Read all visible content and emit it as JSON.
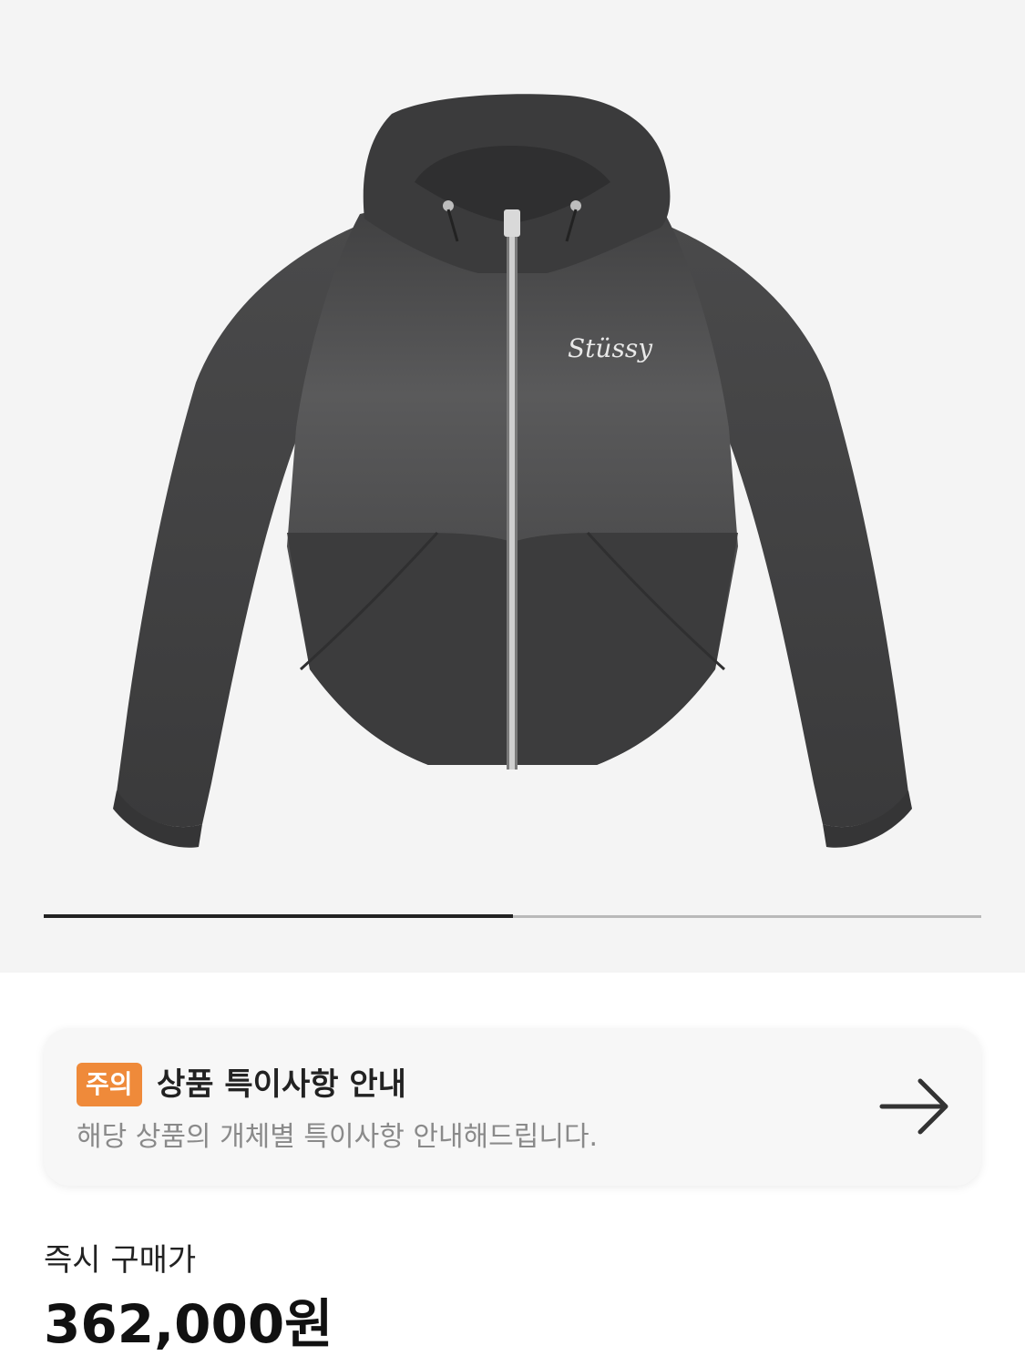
{
  "gallery": {
    "image_alt": "stüssy hooded zip jacket, charcoal",
    "logo_text": "Stüssy",
    "progress_fraction": 0.5
  },
  "notice": {
    "badge": "주의",
    "title": "상품 특이사항 안내",
    "description": "해당 상품의 개체별 특이사항 안내해드립니다.",
    "arrow_icon": "arrow-right-icon",
    "badge_color": "#ef8a3a"
  },
  "price": {
    "label": "즉시 구매가",
    "value": "362,000원"
  },
  "colors": {
    "gallery_bg": "#f4f4f4",
    "jacket": "#4a4a4b",
    "accent": "#ef8a3a"
  }
}
